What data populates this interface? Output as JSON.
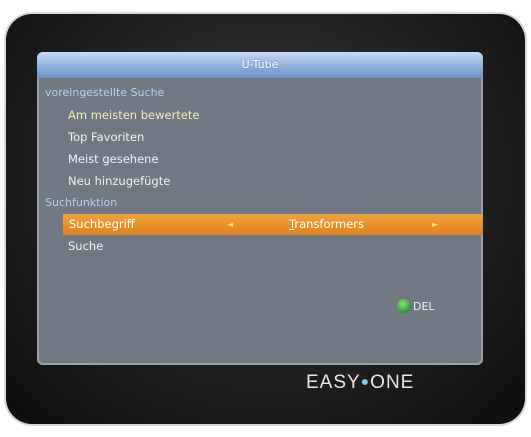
{
  "window": {
    "title": "U-Tube"
  },
  "menu": {
    "preset_header": "voreingestellte Suche",
    "items": [
      {
        "label": "Am meisten bewertete"
      },
      {
        "label": "Top Favoriten"
      },
      {
        "label": "Meist gesehene"
      },
      {
        "label": "Neu hinzugefügte"
      }
    ],
    "search_header": "Suchfunktion",
    "search_term": {
      "label": "Suchbegriff",
      "value_first": "T",
      "value_rest": "ransformers",
      "left_arrow": "◄",
      "right_arrow": "►"
    },
    "search_button": "Suche"
  },
  "hint": {
    "del_label": "DEL",
    "color": "#2f9a2a"
  },
  "brand": {
    "left": "EASY",
    "dot": "●",
    "right": "ONE"
  },
  "colors": {
    "highlight": "#e8901f",
    "screen_bg": "#6f7883",
    "title_bar": "#8fb0dc",
    "section_header": "#b8d2f2"
  }
}
